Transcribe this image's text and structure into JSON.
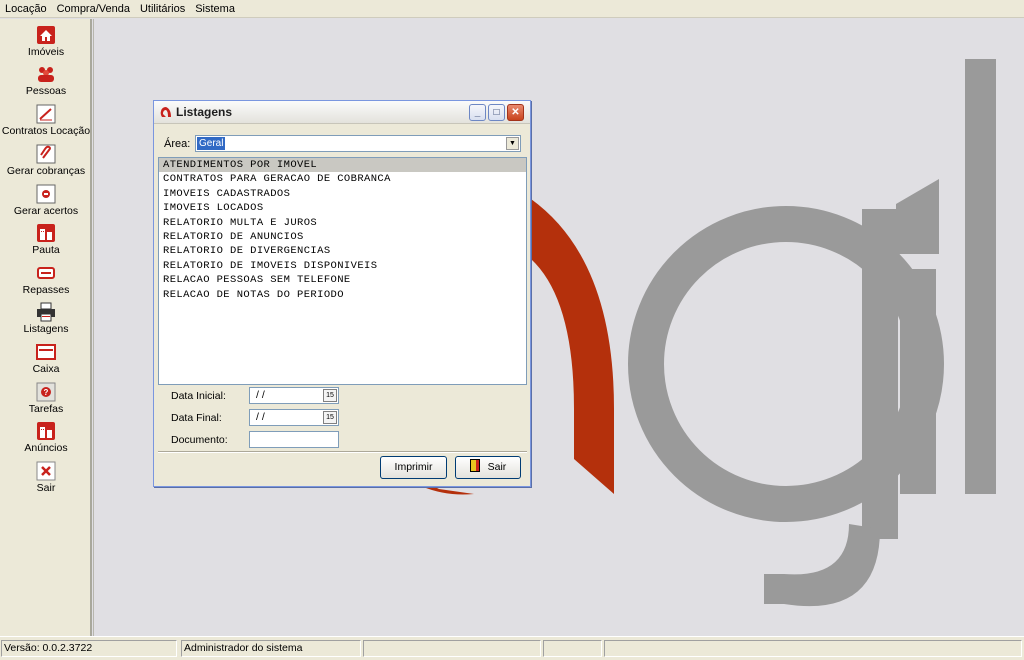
{
  "menu": [
    "Locação",
    "Compra/Venda",
    "Utilitários",
    "Sistema"
  ],
  "sidebar": [
    {
      "label": "Imóveis",
      "icon": "house-icon"
    },
    {
      "label": "Pessoas",
      "icon": "people-icon"
    },
    {
      "label": "Contratos Locação",
      "icon": "contract-pen-icon"
    },
    {
      "label": "Gerar cobranças",
      "icon": "paperclip-icon"
    },
    {
      "label": "Gerar acertos",
      "icon": "calculator-icon"
    },
    {
      "label": "Pauta",
      "icon": "building-icon"
    },
    {
      "label": "Repasses",
      "icon": "transfer-icon"
    },
    {
      "label": "Listagens",
      "icon": "printer-icon"
    },
    {
      "label": "Caixa",
      "icon": "cashbox-icon"
    },
    {
      "label": "Tarefas",
      "icon": "question-icon"
    },
    {
      "label": "Anúncios",
      "icon": "building-icon"
    },
    {
      "label": "Sair",
      "icon": "close-icon"
    }
  ],
  "dialog": {
    "title": "Listagens",
    "area_label": "Área:",
    "area_value": "Geral",
    "items": [
      "ATENDIMENTOS POR IMOVEL",
      "CONTRATOS PARA GERACAO DE COBRANCA",
      "IMOVEIS CADASTRADOS",
      "IMOVEIS LOCADOS",
      "RELATORIO MULTA E JUROS",
      "RELATORIO DE ANUNCIOS",
      "RELATORIO DE DIVERGENCIAS",
      "RELATORIO DE IMOVEIS DISPONIVEIS",
      "RELACAO PESSOAS SEM TELEFONE",
      "RELACAO DE NOTAS DO PERIODO"
    ],
    "selected_item": "ATENDIMENTOS POR IMOVEL",
    "data_inicial_label": "Data Inicial:",
    "data_inicial_value": " / /",
    "data_final_label": "Data Final:",
    "data_final_value": " / /",
    "documento_label": "Documento:",
    "documento_value": "",
    "calendar_glyph": "15",
    "print_label": "Imprimir",
    "exit_label": "Sair"
  },
  "status": {
    "version": "Versão: 0.0.2.3722",
    "user": "Administrador do sistema"
  },
  "colors": {
    "logo_red": "#b4300c",
    "logo_gray": "#9a9a9a",
    "selection": "#316ac5"
  }
}
